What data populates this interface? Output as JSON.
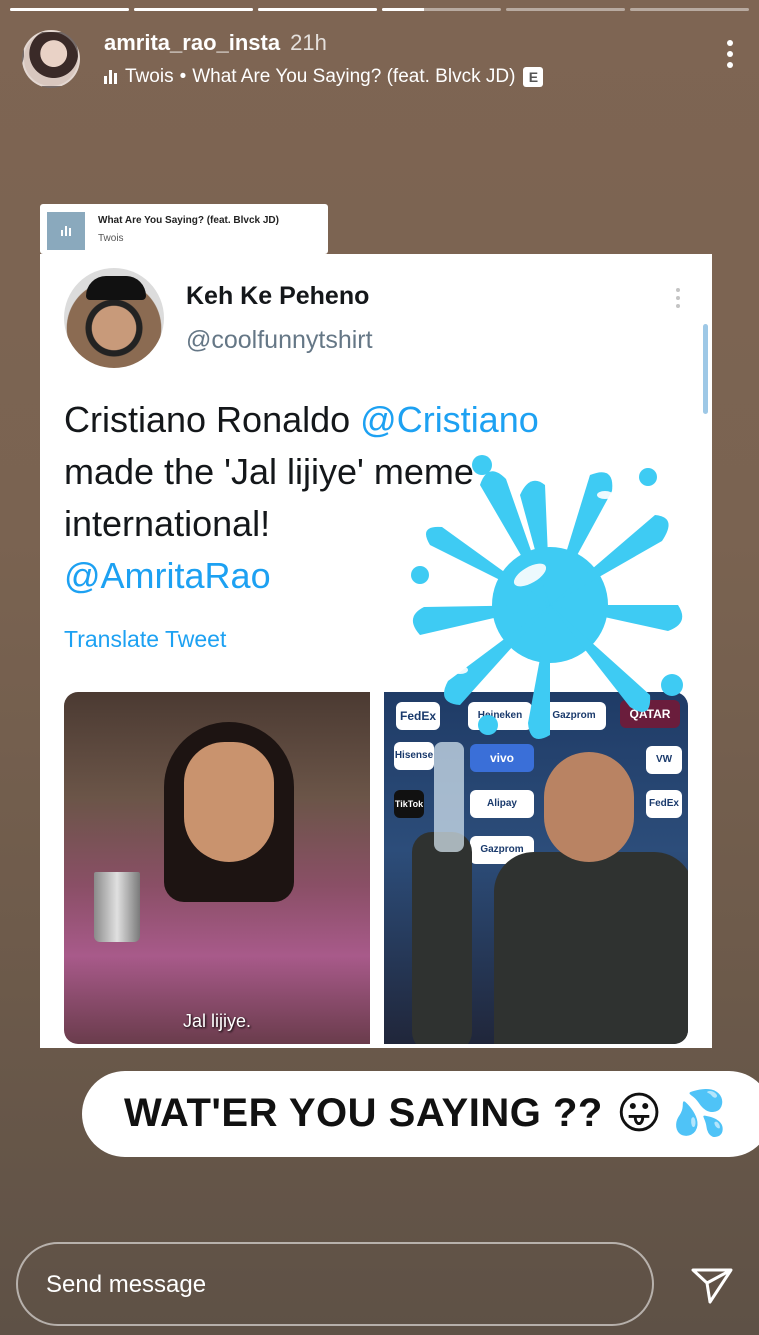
{
  "story": {
    "progress_segments": [
      1,
      1,
      1,
      0.35,
      0,
      0
    ]
  },
  "header": {
    "username": "amrita_rao_insta",
    "time": "21h",
    "music_artist": "Twois",
    "music_separator": "•",
    "music_title": "What Are You Saying? (feat. Blvck JD)",
    "explicit_badge": "E",
    "more_icon": "more-vertical-icon"
  },
  "music_sticker": {
    "title": "What Are You Saying? (feat. Blvck JD)",
    "artist": "Twois"
  },
  "tweet": {
    "name": "Keh Ke Peheno",
    "handle": "@coolfunnytshirt",
    "text_part1": "Cristiano Ronaldo ",
    "mention1": "@Cristiano",
    "text_part2": "made the 'Jal lijiye' meme international!",
    "mention2": "@AmritaRao",
    "translate_label": "Translate Tweet",
    "left_image_caption": "Jal lijiye.",
    "right_image_logos": [
      "FedEx",
      "Heineken",
      "Gazprom",
      "QATAR",
      "Hisense",
      "vivo",
      "VW",
      "TikTok",
      "Alipay",
      "FedEx",
      "Gazprom"
    ]
  },
  "caption": {
    "text": "WAT'ER YOU SAYING ??",
    "emoji1": "😛",
    "emoji2": "💦"
  },
  "reply": {
    "placeholder": "Send message",
    "send_icon": "send-icon"
  },
  "colors": {
    "background": "#7a6351",
    "splash": "#3ecbf3",
    "twitter_blue": "#1da1f2"
  }
}
